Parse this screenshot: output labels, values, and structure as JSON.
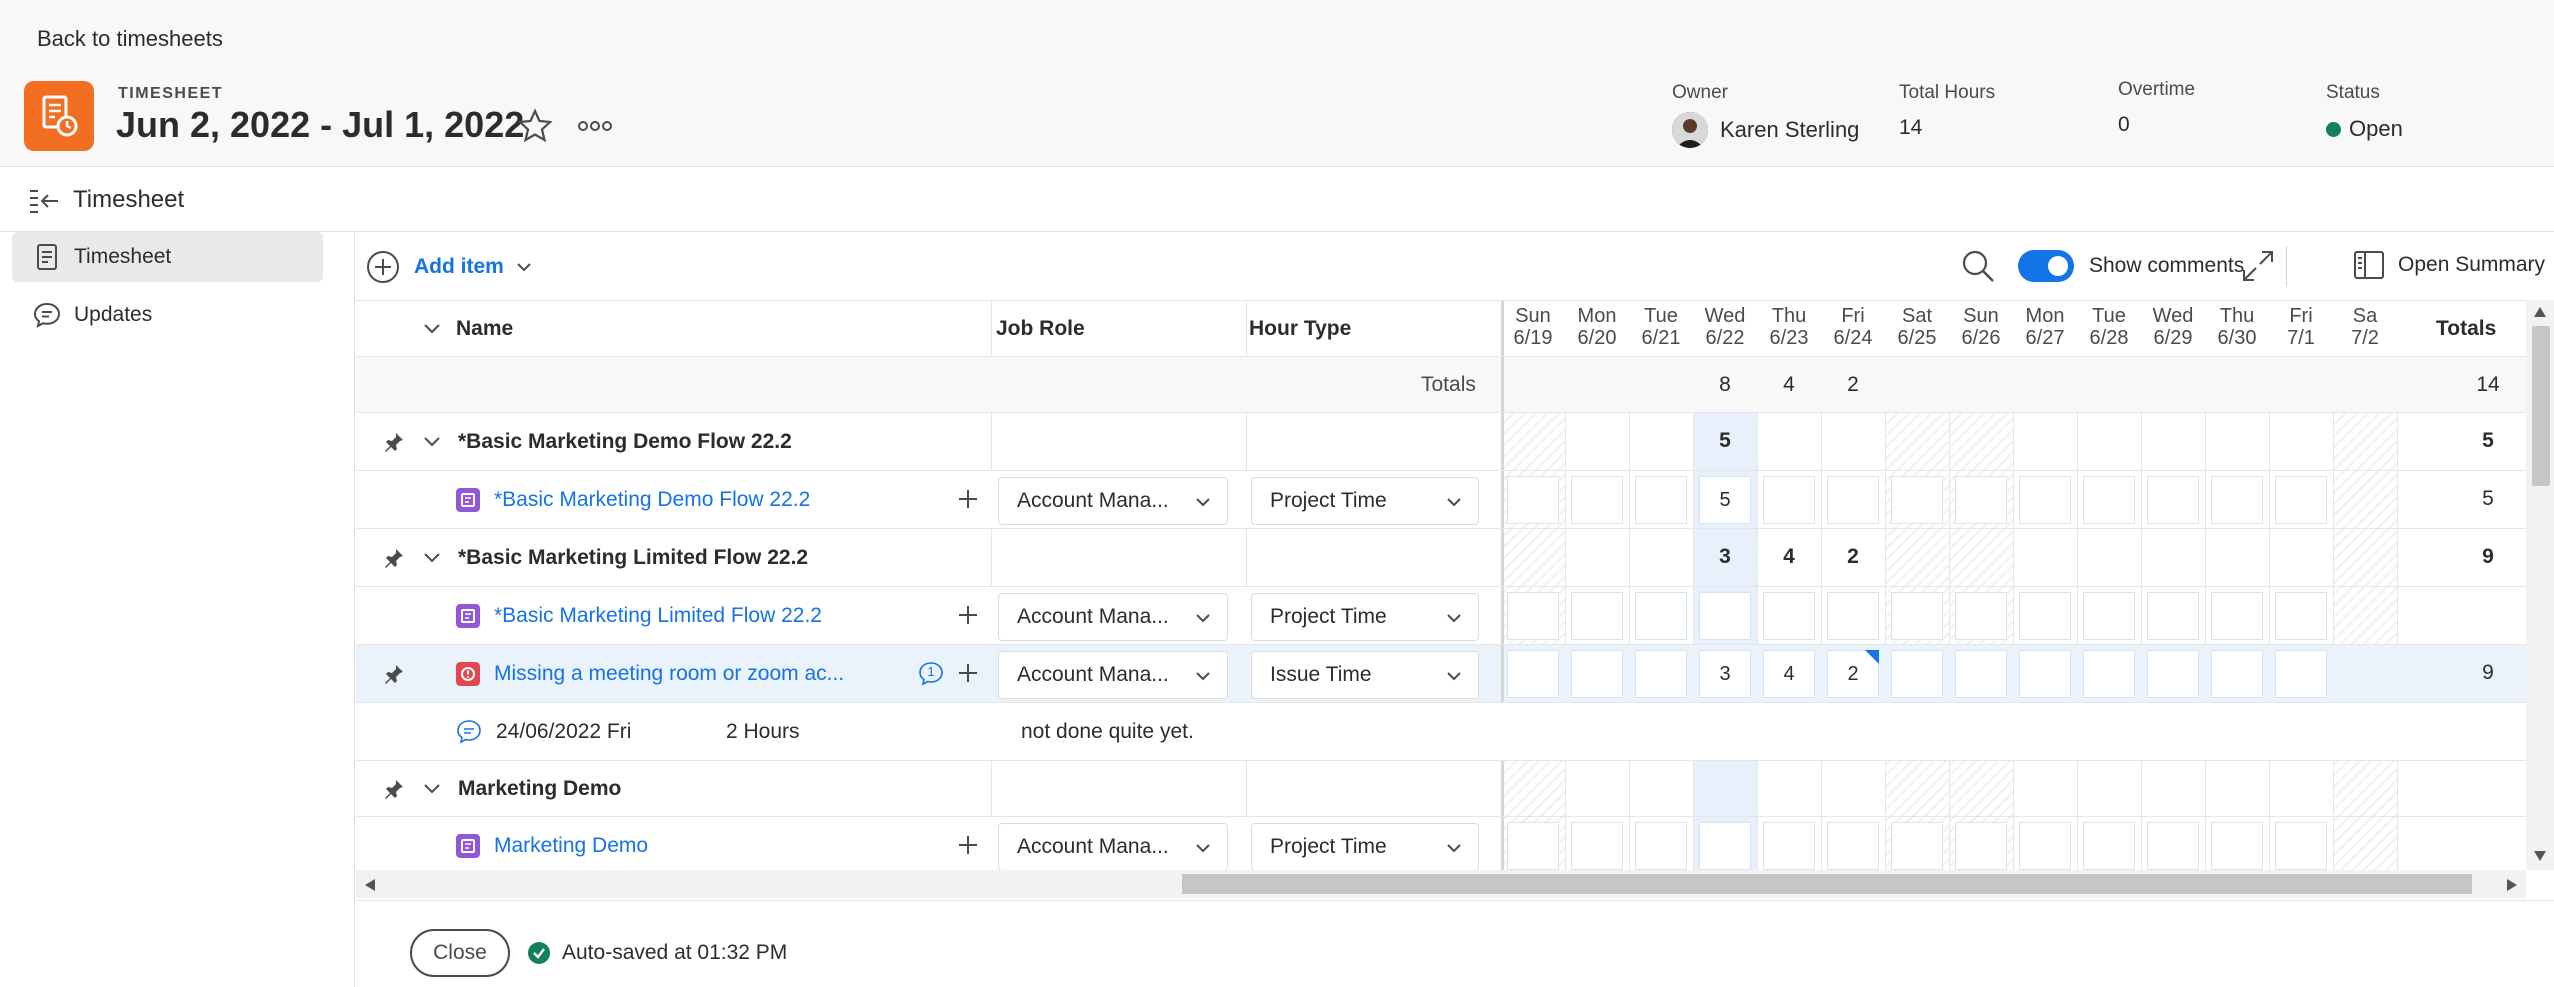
{
  "header": {
    "back_link": "Back to timesheets",
    "doc_type": "TIMESHEET",
    "title": "Jun 2, 2022 - Jul 1, 2022",
    "owner_label": "Owner",
    "owner_name": "Karen Sterling",
    "total_hours_label": "Total Hours",
    "total_hours_value": "14",
    "overtime_label": "Overtime",
    "overtime_value": "0",
    "status_label": "Status",
    "status_value": "Open"
  },
  "titlebar": {
    "label": "Timesheet"
  },
  "nav": {
    "items": [
      {
        "label": "Timesheet"
      },
      {
        "label": "Updates"
      }
    ]
  },
  "toolbar": {
    "add_item": "Add item",
    "show_comments": "Show comments",
    "open_summary": "Open Summary"
  },
  "grid": {
    "columns": {
      "name": "Name",
      "job_role": "Job Role",
      "hour_type": "Hour Type",
      "totals": "Totals"
    },
    "days": [
      {
        "dow": "Sun",
        "date": "6/19"
      },
      {
        "dow": "Mon",
        "date": "6/20"
      },
      {
        "dow": "Tue",
        "date": "6/21"
      },
      {
        "dow": "Wed",
        "date": "6/22"
      },
      {
        "dow": "Thu",
        "date": "6/23"
      },
      {
        "dow": "Fri",
        "date": "6/24"
      },
      {
        "dow": "Sat",
        "date": "6/25"
      },
      {
        "dow": "Sun",
        "date": "6/26"
      },
      {
        "dow": "Mon",
        "date": "6/27"
      },
      {
        "dow": "Tue",
        "date": "6/28"
      },
      {
        "dow": "Wed",
        "date": "6/29"
      },
      {
        "dow": "Thu",
        "date": "6/30"
      },
      {
        "dow": "Fri",
        "date": "7/1"
      },
      {
        "dow": "Sa",
        "date": "7/2"
      }
    ],
    "totals_row": {
      "label": "Totals",
      "wed": "8",
      "thu": "4",
      "fri": "2",
      "total": "14"
    },
    "groups": [
      {
        "name": "*Basic Marketing Demo Flow 22.2",
        "wed": "5",
        "thu": "",
        "fri": "",
        "total": "5"
      },
      {
        "name": "*Basic Marketing Limited Flow 22.2",
        "wed": "3",
        "thu": "4",
        "fri": "2",
        "total": "9"
      },
      {
        "name": "Marketing Demo",
        "wed": "",
        "thu": "",
        "fri": "",
        "total": ""
      }
    ],
    "tasks": [
      {
        "name": "*Basic Marketing Demo Flow 22.2",
        "job_role": "Account Mana...",
        "hour_type": "Project Time",
        "wed": "5",
        "thu": "",
        "fri": "",
        "total": "5"
      },
      {
        "name": "*Basic Marketing Limited Flow 22.2",
        "job_role": "Account Mana...",
        "hour_type": "Project Time",
        "wed": "",
        "thu": "",
        "fri": "",
        "total": ""
      },
      {
        "name": "Missing a meeting room or zoom ac...",
        "job_role": "Account Mana...",
        "hour_type": "Issue Time",
        "wed": "3",
        "thu": "4",
        "fri": "2",
        "total": "9",
        "comment_count": "1"
      },
      {
        "name": "Marketing Demo",
        "job_role": "Account Mana...",
        "hour_type": "Project Time",
        "wed": "",
        "thu": "",
        "fri": "",
        "total": ""
      }
    ],
    "comment": {
      "date": "24/06/2022 Fri",
      "hours": "2 Hours",
      "text": "not done quite yet."
    }
  },
  "footer": {
    "close": "Close",
    "autosave": "Auto-saved at 01:32 PM"
  },
  "colors": {
    "accent": "#1473e6",
    "brand": "#f26f22",
    "status_open": "#12805c",
    "task_icon": "#9256d9",
    "issue_icon": "#e34850"
  }
}
